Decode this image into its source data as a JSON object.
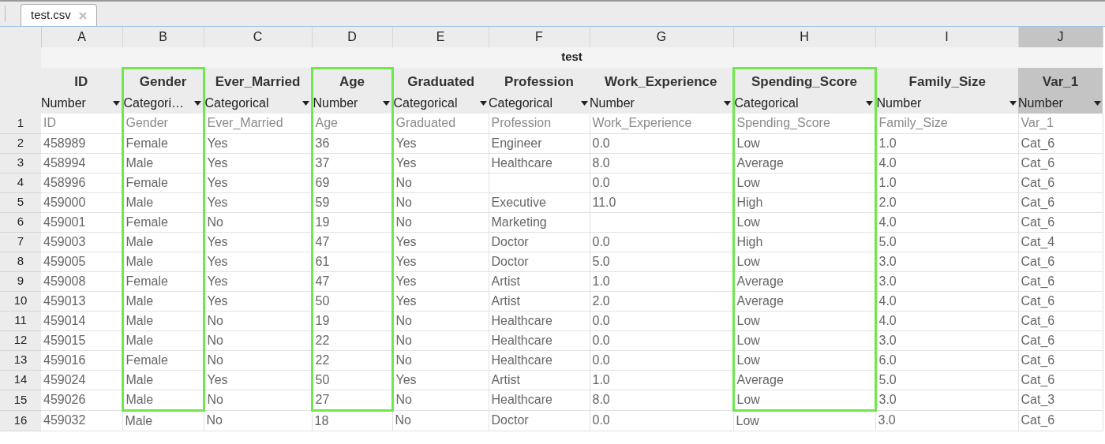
{
  "tab": {
    "label": "test.csv",
    "selected": true
  },
  "sheet_title": "test",
  "columns": [
    {
      "letter": "A",
      "name": "ID",
      "type": "Number",
      "highlighted": false,
      "selected": false
    },
    {
      "letter": "B",
      "name": "Gender",
      "type": "Categori…",
      "highlighted": true,
      "selected": false
    },
    {
      "letter": "C",
      "name": "Ever_Married",
      "type": "Categorical",
      "highlighted": false,
      "selected": false
    },
    {
      "letter": "D",
      "name": "Age",
      "type": "Number",
      "highlighted": true,
      "selected": false
    },
    {
      "letter": "E",
      "name": "Graduated",
      "type": "Categorical",
      "highlighted": false,
      "selected": false
    },
    {
      "letter": "F",
      "name": "Profession",
      "type": "Categorical",
      "highlighted": false,
      "selected": false
    },
    {
      "letter": "G",
      "name": "Work_Experience",
      "type": "Number",
      "highlighted": false,
      "selected": false
    },
    {
      "letter": "H",
      "name": "Spending_Score",
      "type": "Categorical",
      "highlighted": true,
      "selected": false
    },
    {
      "letter": "I",
      "name": "Family_Size",
      "type": "Number",
      "highlighted": false,
      "selected": false
    },
    {
      "letter": "J",
      "name": "Var_1",
      "type": "Number",
      "highlighted": false,
      "selected": true
    }
  ],
  "rows": [
    {
      "number": "1",
      "boxed": true,
      "cells": [
        "ID",
        "Gender",
        "Ever_Married",
        "Age",
        "Graduated",
        "Profession",
        "Work_Experience",
        "Spending_Score",
        "Family_Size",
        "Var_1"
      ]
    },
    {
      "number": "2",
      "boxed": true,
      "cells": [
        "458989",
        "Female",
        "Yes",
        "36",
        "Yes",
        "Engineer",
        "0.0",
        "Low",
        "1.0",
        "Cat_6"
      ]
    },
    {
      "number": "3",
      "boxed": true,
      "cells": [
        "458994",
        "Male",
        "Yes",
        "37",
        "Yes",
        "Healthcare",
        "8.0",
        "Average",
        "4.0",
        "Cat_6"
      ]
    },
    {
      "number": "4",
      "boxed": true,
      "cells": [
        "458996",
        "Female",
        "Yes",
        "69",
        "No",
        null,
        "0.0",
        "Low",
        "1.0",
        "Cat_6"
      ]
    },
    {
      "number": "5",
      "boxed": true,
      "cells": [
        "459000",
        "Male",
        "Yes",
        "59",
        "No",
        "Executive",
        "11.0",
        "High",
        "2.0",
        "Cat_6"
      ]
    },
    {
      "number": "6",
      "boxed": true,
      "cells": [
        "459001",
        "Female",
        "No",
        "19",
        "No",
        "Marketing",
        null,
        "Low",
        "4.0",
        "Cat_6"
      ]
    },
    {
      "number": "7",
      "boxed": true,
      "cells": [
        "459003",
        "Male",
        "Yes",
        "47",
        "Yes",
        "Doctor",
        "0.0",
        "High",
        "5.0",
        "Cat_4"
      ]
    },
    {
      "number": "8",
      "boxed": true,
      "cells": [
        "459005",
        "Male",
        "Yes",
        "61",
        "Yes",
        "Doctor",
        "5.0",
        "Low",
        "3.0",
        "Cat_6"
      ]
    },
    {
      "number": "9",
      "boxed": true,
      "cells": [
        "459008",
        "Female",
        "Yes",
        "47",
        "Yes",
        "Artist",
        "1.0",
        "Average",
        "3.0",
        "Cat_6"
      ]
    },
    {
      "number": "10",
      "boxed": true,
      "cells": [
        "459013",
        "Male",
        "Yes",
        "50",
        "Yes",
        "Artist",
        "2.0",
        "Average",
        "4.0",
        "Cat_6"
      ]
    },
    {
      "number": "11",
      "boxed": true,
      "cells": [
        "459014",
        "Male",
        "No",
        "19",
        "No",
        "Healthcare",
        "0.0",
        "Low",
        "4.0",
        "Cat_6"
      ]
    },
    {
      "number": "12",
      "boxed": true,
      "cells": [
        "459015",
        "Male",
        "No",
        "22",
        "No",
        "Healthcare",
        "0.0",
        "Low",
        "3.0",
        "Cat_6"
      ]
    },
    {
      "number": "13",
      "boxed": true,
      "cells": [
        "459016",
        "Female",
        "No",
        "22",
        "No",
        "Healthcare",
        "0.0",
        "Low",
        "6.0",
        "Cat_6"
      ]
    },
    {
      "number": "14",
      "boxed": true,
      "cells": [
        "459024",
        "Male",
        "Yes",
        "50",
        "Yes",
        "Artist",
        "1.0",
        "Average",
        "5.0",
        "Cat_6"
      ]
    },
    {
      "number": "15",
      "boxed": true,
      "cells": [
        "459026",
        "Male",
        "No",
        "27",
        "No",
        "Healthcare",
        "8.0",
        "Low",
        "3.0",
        "Cat_3"
      ]
    },
    {
      "number": "16",
      "boxed": false,
      "cells": [
        "459032",
        "Male",
        "No",
        "18",
        "No",
        "Doctor",
        "0.0",
        "Low",
        "3.0",
        "Cat_6"
      ]
    }
  ]
}
